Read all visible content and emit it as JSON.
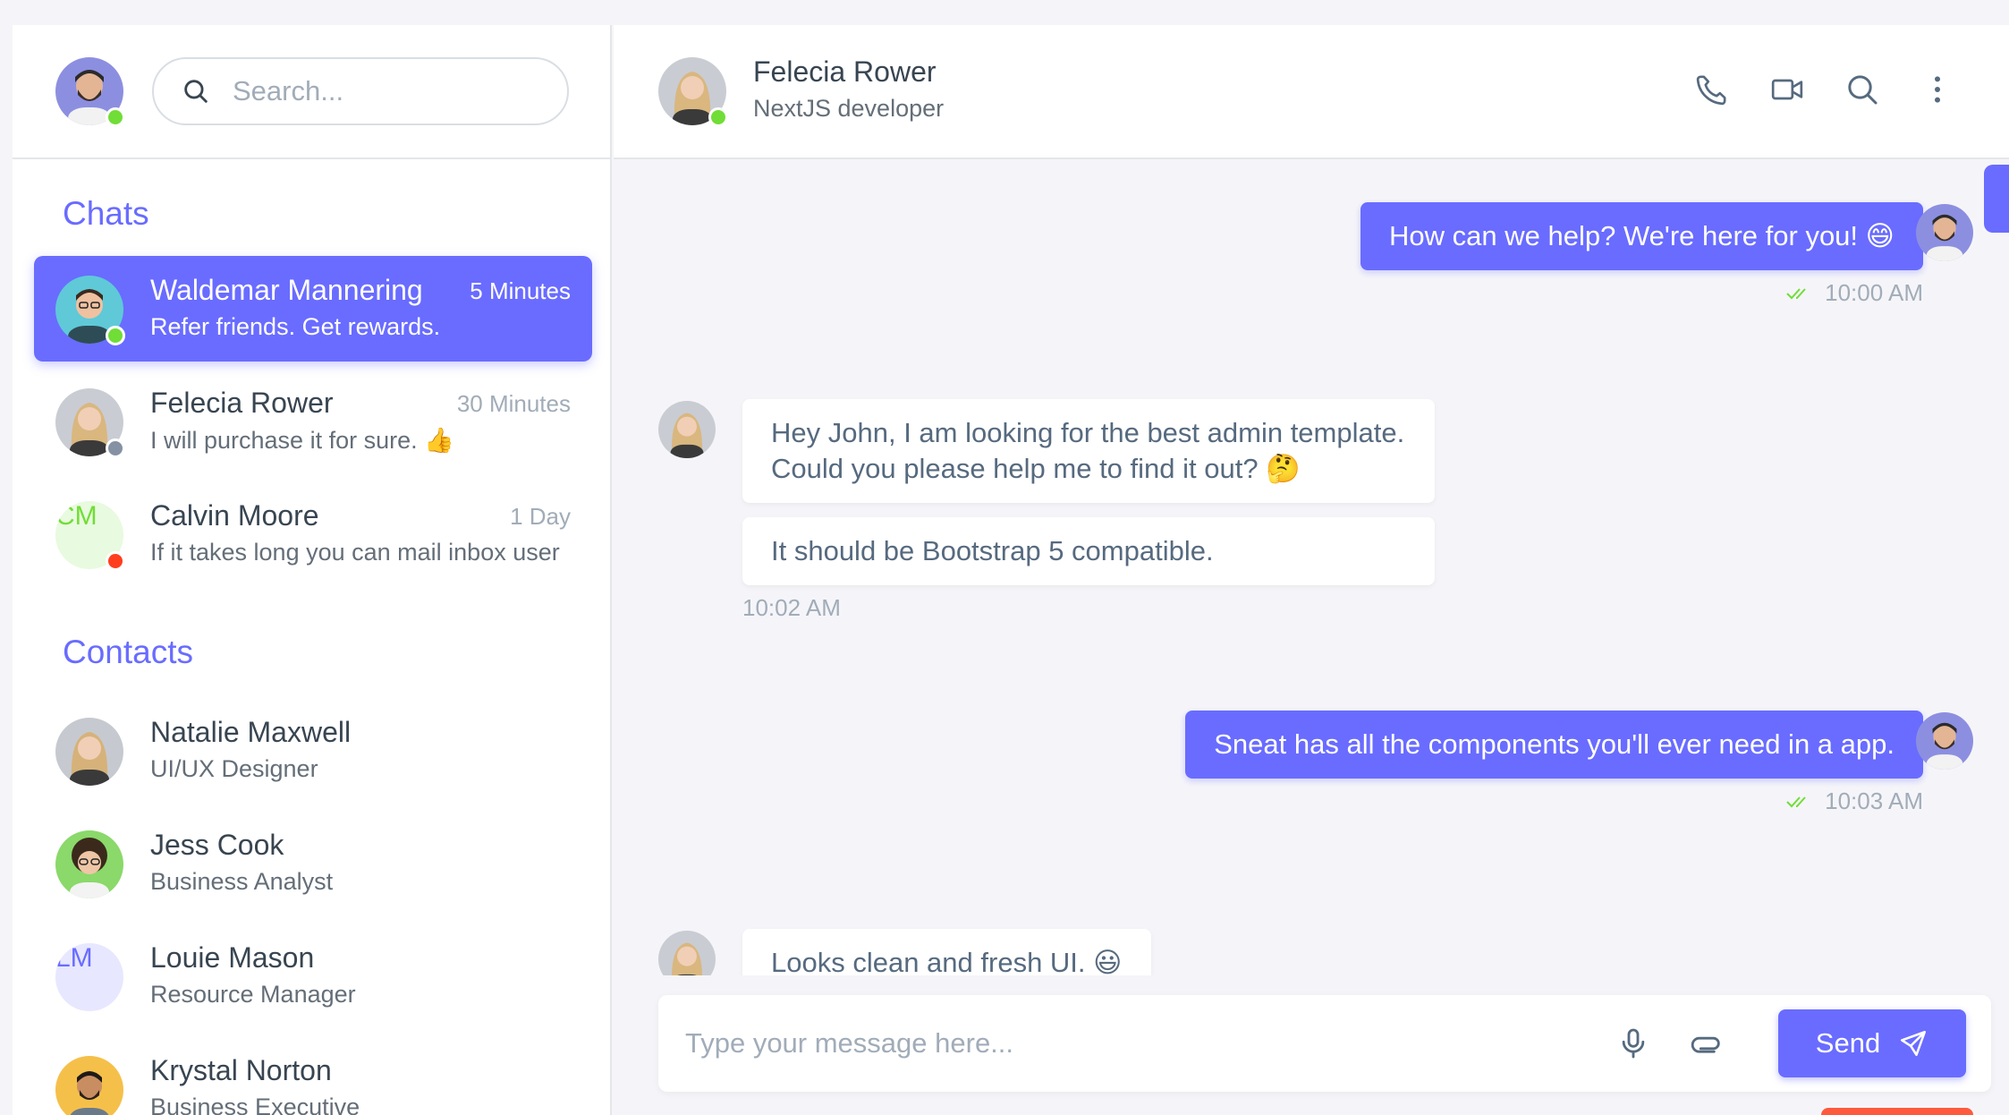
{
  "sidebar": {
    "search_placeholder": "Search...",
    "chats_title": "Chats",
    "contacts_title": "Contacts",
    "chats": [
      {
        "name": "Waldemar Mannering",
        "preview": "Refer friends. Get rewards.",
        "time": "5 Minutes",
        "status": "online"
      },
      {
        "name": "Felecia Rower",
        "preview": "I will purchase it for sure.",
        "emoji": "👍",
        "time": "30 Minutes",
        "status": "offline"
      },
      {
        "name": "Calvin Moore",
        "initials": "CM",
        "preview": "If it takes long you can mail inbox user",
        "time": "1 Day",
        "status": "busy"
      }
    ],
    "contacts": [
      {
        "name": "Natalie Maxwell",
        "role": "UI/UX Designer"
      },
      {
        "name": "Jess Cook",
        "role": "Business Analyst"
      },
      {
        "name": "Louie Mason",
        "initials": "LM",
        "role": "Resource Manager"
      },
      {
        "name": "Krystal Norton",
        "role": "Business Executive"
      }
    ]
  },
  "header": {
    "name": "Felecia Rower",
    "role": "NextJS developer",
    "icons": [
      "phone-icon",
      "video-icon",
      "search-icon",
      "more-vertical-icon"
    ]
  },
  "messages": [
    {
      "side": "out",
      "text": "How can we help? We're here for you!",
      "emoji": "😄",
      "time": "10:00 AM"
    },
    {
      "side": "in",
      "lines": [
        "Hey John, I am looking for the best admin template.",
        "Could you please help me to find it out?"
      ],
      "emoji": "🤔"
    },
    {
      "side": "in",
      "text": "It should be Bootstrap 5 compatible.",
      "time": "10:02 AM"
    },
    {
      "side": "out",
      "text": "Sneat has all the components you'll ever need in a app.",
      "time": "10:03 AM"
    },
    {
      "side": "in",
      "text": "Looks clean and fresh UI.",
      "emoji": "😃"
    }
  ],
  "composer": {
    "placeholder": "Type your message here...",
    "send_label": "Send"
  },
  "colors": {
    "primary": "#696cff",
    "online": "#71dd37",
    "offline": "#8592a3",
    "busy": "#ff3e1d"
  }
}
